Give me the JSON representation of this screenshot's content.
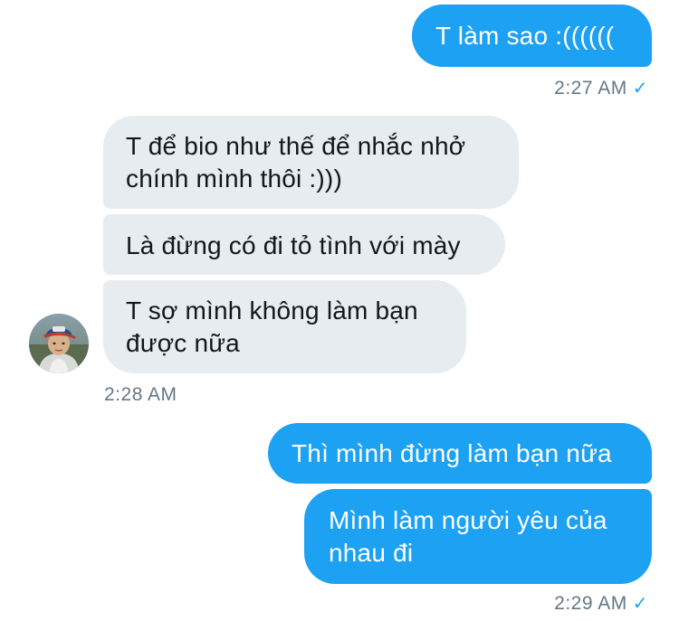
{
  "messages": [
    {
      "direction": "outgoing",
      "lines": [
        "T làm sao :(((((("
      ]
    },
    {
      "direction": "incoming",
      "lines": [
        "T để bio như thế để nhắc nhở",
        "chính mình thôi :)))"
      ]
    },
    {
      "direction": "incoming",
      "lines": [
        "Là đừng có đi tỏ tình với mày"
      ]
    },
    {
      "direction": "incoming",
      "lines": [
        "T sợ mình không làm bạn",
        "được nữa"
      ]
    },
    {
      "direction": "outgoing",
      "lines": [
        "Thì mình đừng làm bạn nữa"
      ]
    },
    {
      "direction": "outgoing",
      "lines": [
        "Mình làm người yêu của",
        "nhau đi"
      ]
    }
  ],
  "timestamps": {
    "first": "2:27 AM",
    "second": "2:28 AM",
    "third": "2:29 AM"
  },
  "read_receipt_icon": "checkmark-icon",
  "colors": {
    "outgoing_bubble": "#1da1f2",
    "incoming_bubble": "#e6ecf0",
    "timestamp": "#657786",
    "checkmark": "#1da1f2"
  }
}
